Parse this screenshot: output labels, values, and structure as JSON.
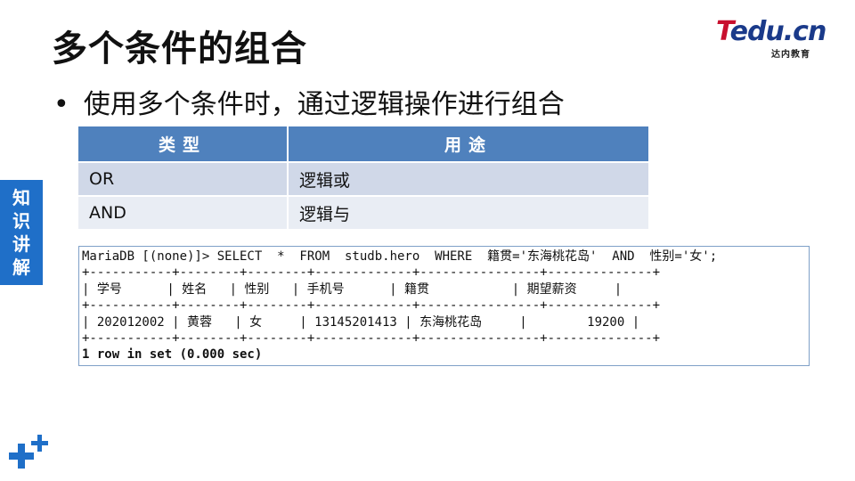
{
  "slide": {
    "title": "多个条件的组合",
    "bullet": "使用多个条件时，通过逻辑操作进行组合"
  },
  "logo": {
    "brand_t": "T",
    "brand_rest": "edu.cn",
    "subtitle": "达内教育"
  },
  "side_tab": {
    "label_chars": [
      "知",
      "识",
      "讲",
      "解"
    ]
  },
  "table": {
    "headers": [
      "类型",
      "用途"
    ],
    "rows": [
      [
        "OR",
        "逻辑或"
      ],
      [
        "AND",
        "逻辑与"
      ]
    ]
  },
  "terminal": {
    "lines": [
      "MariaDB [(none)]> SELECT  *  FROM  studb.hero  WHERE  籍贯='东海桃花岛'  AND  性别='女';",
      "+-----------+--------+--------+-------------+----------------+--------------+",
      "| 学号      | 姓名   | 性别   | 手机号      | 籍贯           | 期望薪资     |",
      "+-----------+--------+--------+-------------+----------------+--------------+",
      "| 202012002 | 黄蓉   | 女     | 13145201413 | 东海桃花岛     |        19200 |",
      "+-----------+--------+--------+-------------+----------------+--------------+"
    ],
    "footer": "1 row in set (0.000 sec)"
  },
  "colors": {
    "header_blue": "#4f81bd",
    "row_odd": "#d0d8e8",
    "row_even": "#e9edf4",
    "side_tab_blue": "#1f6fc8",
    "logo_red": "#c8102e",
    "logo_navy": "#1a3a8a"
  },
  "icons": [
    "plus-logo-icon"
  ]
}
